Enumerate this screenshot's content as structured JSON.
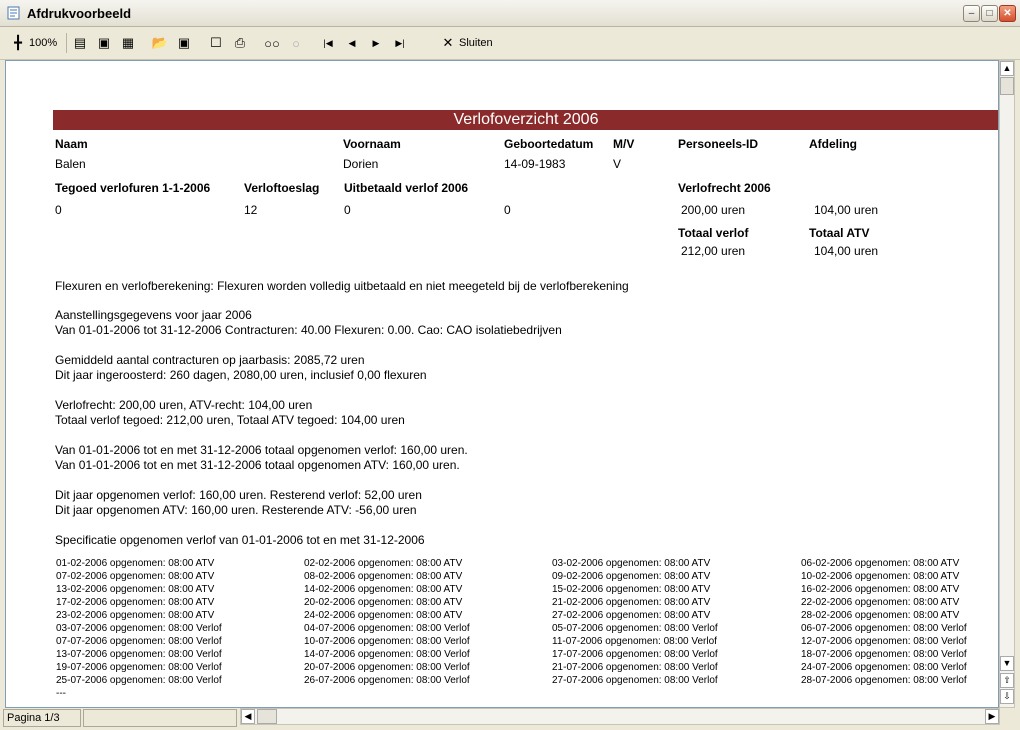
{
  "window": {
    "title": "Afdrukvoorbeeld"
  },
  "toolbar": {
    "zoom_label": "100%",
    "close_label": "Sluiten"
  },
  "status": {
    "page": "Pagina 1/3"
  },
  "report": {
    "title": "Verlofoverzicht 2006",
    "h_naam": "Naam",
    "h_voornaam": "Voornaam",
    "h_geboortedatum": "Geboortedatum",
    "h_mv": "M/V",
    "h_personeels_id": "Personeels-ID",
    "h_afdeling": "Afdeling",
    "naam": "Balen",
    "voornaam": "Dorien",
    "geboortedatum": "14-09-1983",
    "mv": "V",
    "h_tegoed": "Tegoed verlofuren 1-1-2006",
    "h_toeslag": "Verloftoeslag",
    "h_uitbetaald": "Uitbetaald verlof 2006",
    "h_verlofrecht": "Verlofrecht 2006",
    "tegoed": "0",
    "toeslag": "12",
    "uitbetaald": "0",
    "extra": "0",
    "verlofrecht": "200,00 uren",
    "atv_recht": "104,00 uren",
    "h_totaal_verlof": "Totaal verlof",
    "h_totaal_atv": "Totaal ATV",
    "totaal_verlof": "212,00 uren",
    "totaal_atv": "104,00 uren",
    "lines": [
      "Flexuren en verlofberekening: Flexuren worden volledig uitbetaald en niet meegeteld bij de verlofberekening",
      "Aanstellingsgegevens voor jaar 2006",
      "Van 01-01-2006 tot 31-12-2006 Contracturen:  40.00 Flexuren:   0.00. Cao: CAO isolatiebedrijven",
      "Gemiddeld aantal contracturen op jaarbasis: 2085,72 uren",
      "Dit jaar ingeroosterd: 260 dagen, 2080,00 uren, inclusief    0,00 flexuren",
      "Verlofrecht:  200,00 uren, ATV-recht:  104,00 uren",
      "Totaal verlof tegoed:  212,00 uren, Totaal ATV tegoed:  104,00 uren",
      "Van 01-01-2006 tot en met 31-12-2006 totaal opgenomen verlof:  160,00 uren.",
      "Van 01-01-2006 tot en met 31-12-2006 totaal opgenomen ATV:     160,00 uren.",
      "Dit jaar opgenomen verlof:  160,00 uren. Resterend verlof:   52,00 uren",
      "Dit jaar opgenomen ATV:     160,00 uren. Resterende ATV:  -56,00 uren",
      "Specificatie opgenomen verlof van 01-01-2006 tot en met 31-12-2006"
    ],
    "spec": [
      [
        "01-02-2006 opgenomen: 08:00 ATV",
        "02-02-2006 opgenomen: 08:00 ATV",
        "03-02-2006 opgenomen: 08:00 ATV",
        "06-02-2006 opgenomen: 08:00 ATV"
      ],
      [
        "07-02-2006 opgenomen: 08:00 ATV",
        "08-02-2006 opgenomen: 08:00 ATV",
        "09-02-2006 opgenomen: 08:00 ATV",
        "10-02-2006 opgenomen: 08:00 ATV"
      ],
      [
        "13-02-2006 opgenomen: 08:00 ATV",
        "14-02-2006 opgenomen: 08:00 ATV",
        "15-02-2006 opgenomen: 08:00 ATV",
        "16-02-2006 opgenomen: 08:00 ATV"
      ],
      [
        "17-02-2006 opgenomen: 08:00 ATV",
        "20-02-2006 opgenomen: 08:00 ATV",
        "21-02-2006 opgenomen: 08:00 ATV",
        "22-02-2006 opgenomen: 08:00 ATV"
      ],
      [
        "23-02-2006 opgenomen: 08:00 ATV",
        "24-02-2006 opgenomen: 08:00 ATV",
        "27-02-2006 opgenomen: 08:00 ATV",
        "28-02-2006 opgenomen: 08:00 ATV"
      ],
      [
        "03-07-2006 opgenomen: 08:00 Verlof",
        "04-07-2006 opgenomen: 08:00 Verlof",
        "05-07-2006 opgenomen: 08:00 Verlof",
        "06-07-2006 opgenomen: 08:00 Verlof"
      ],
      [
        "07-07-2006 opgenomen: 08:00 Verlof",
        "10-07-2006 opgenomen: 08:00 Verlof",
        "11-07-2006 opgenomen: 08:00 Verlof",
        "12-07-2006 opgenomen: 08:00 Verlof"
      ],
      [
        "13-07-2006 opgenomen: 08:00 Verlof",
        "14-07-2006 opgenomen: 08:00 Verlof",
        "17-07-2006 opgenomen: 08:00 Verlof",
        "18-07-2006 opgenomen: 08:00 Verlof"
      ],
      [
        "19-07-2006 opgenomen: 08:00 Verlof",
        "20-07-2006 opgenomen: 08:00 Verlof",
        "21-07-2006 opgenomen: 08:00 Verlof",
        "24-07-2006 opgenomen: 08:00 Verlof"
      ],
      [
        "25-07-2006 opgenomen: 08:00 Verlof",
        "26-07-2006 opgenomen: 08:00 Verlof",
        "27-07-2006 opgenomen: 08:00 Verlof",
        "28-07-2006 opgenomen: 08:00 Verlof"
      ]
    ],
    "ellipsis": "---"
  }
}
